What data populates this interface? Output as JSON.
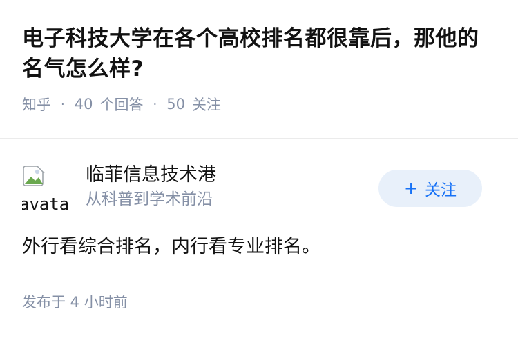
{
  "question": {
    "title": "电子科技大学在各个高校排名都很靠后，那他的名气怎么样?",
    "source": "知乎",
    "answer_count": "40",
    "answer_unit": "个回答",
    "follower_count": "50",
    "follower_unit": "关注",
    "separator": "·"
  },
  "answer": {
    "author": {
      "avatar_alt": "avatar",
      "name": "临菲信息技术港",
      "headline": "从科普到学术前沿"
    },
    "follow_button": {
      "plus": "+",
      "label": "关注"
    },
    "content": "外行看综合排名，内行看专业排名。",
    "published_time": "发布于 4 小时前"
  },
  "colors": {
    "title": "#121212",
    "meta": "#8590a6",
    "accent": "#1772f6",
    "button_bg": "#e8f0fa",
    "divider": "#ebebeb"
  }
}
